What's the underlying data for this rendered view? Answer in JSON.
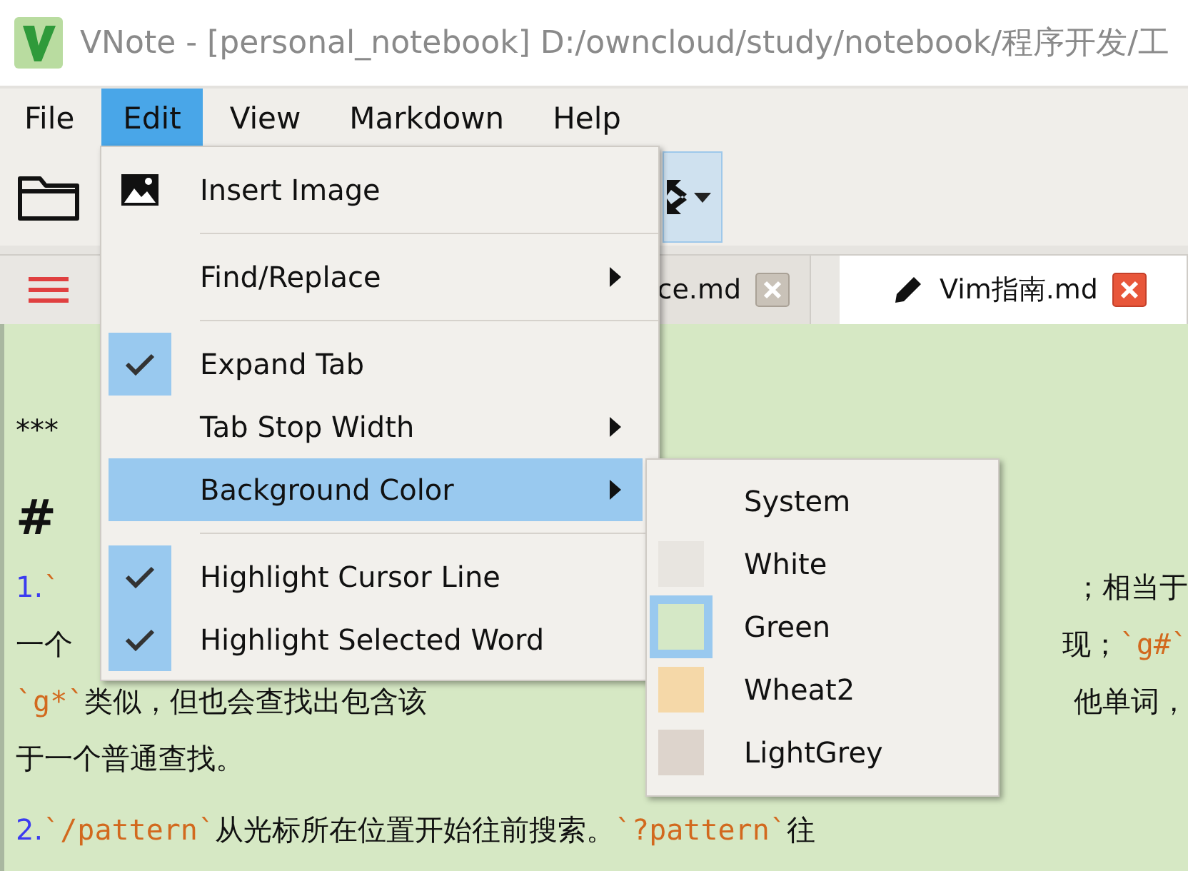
{
  "window": {
    "title": "VNote - [personal_notebook] D:/owncloud/study/notebook/程序开发/工"
  },
  "menubar": [
    {
      "label": "File",
      "selected": false
    },
    {
      "label": "Edit",
      "selected": true
    },
    {
      "label": "View",
      "selected": false
    },
    {
      "label": "Markdown",
      "selected": false
    },
    {
      "label": "Help",
      "selected": false
    }
  ],
  "tabs": [
    {
      "label": "ce.md",
      "selected": false,
      "modified": false
    },
    {
      "label": "Vim指南.md",
      "selected": true,
      "modified": true
    }
  ],
  "editor": {
    "lines": [
      {
        "kind": "plain",
        "left": [
          {
            "kind": "text",
            "text": "***"
          }
        ]
      },
      {
        "kind": "heading",
        "left": [
          {
            "kind": "text",
            "text": "#"
          }
        ]
      },
      {
        "kind": "plain",
        "left": [
          {
            "kind": "marker",
            "text": "1."
          },
          {
            "kind": "code",
            "text": "`"
          }
        ],
        "right": [
          {
            "kind": "text",
            "text": "；相当于"
          }
        ]
      },
      {
        "kind": "plain",
        "left": [
          {
            "kind": "text",
            "text": "一个"
          }
        ],
        "right": [
          {
            "kind": "text",
            "text": "现；"
          },
          {
            "kind": "code",
            "text": "`g#`"
          }
        ]
      },
      {
        "kind": "plain",
        "left": [
          {
            "kind": "code",
            "text": "`g*`"
          },
          {
            "kind": "text",
            "text": "类似，但也会查找出包含该"
          }
        ],
        "right": [
          {
            "kind": "text",
            "text": "他单词，"
          }
        ]
      },
      {
        "kind": "plain",
        "left": [
          {
            "kind": "text",
            "text": "于一个普通查找。"
          }
        ]
      },
      {
        "kind": "gap",
        "left": [
          {
            "kind": "marker",
            "text": "2."
          },
          {
            "kind": "code",
            "text": " `/pattern` "
          },
          {
            "kind": "text",
            "text": "从光标所在位置开始往前搜索。"
          },
          {
            "kind": "code",
            "text": "`?pattern`"
          },
          {
            "kind": "text",
            "text": " 往"
          }
        ]
      }
    ]
  },
  "edit_menu": {
    "groups": [
      [
        {
          "label": "Insert Image",
          "kind": "icon",
          "checked": false,
          "submenu": false,
          "selected": false
        }
      ],
      [
        {
          "label": "Find/Replace",
          "kind": "plain",
          "checked": false,
          "submenu": true,
          "selected": false
        }
      ],
      [
        {
          "label": "Expand Tab",
          "kind": "plain",
          "checked": true,
          "submenu": false,
          "selected": false
        },
        {
          "label": "Tab Stop Width",
          "kind": "plain",
          "checked": false,
          "submenu": true,
          "selected": false
        },
        {
          "label": "Background Color",
          "kind": "plain",
          "checked": false,
          "submenu": true,
          "selected": true
        }
      ],
      [
        {
          "label": "Highlight Cursor Line",
          "kind": "plain",
          "checked": true,
          "submenu": false,
          "selected": false
        },
        {
          "label": "Highlight Selected Word",
          "kind": "plain",
          "checked": true,
          "submenu": false,
          "selected": false
        }
      ]
    ]
  },
  "color_menu": [
    {
      "label": "System",
      "selected": false
    },
    {
      "label": "White",
      "color": "#e8e5e0",
      "selected": false
    },
    {
      "label": "Green",
      "color": "#d5e8c6",
      "selected": true
    },
    {
      "label": "Wheat2",
      "color": "#f5d8a8",
      "selected": false
    },
    {
      "label": "LightGrey",
      "color": "#ddd4cc",
      "selected": false
    }
  ]
}
